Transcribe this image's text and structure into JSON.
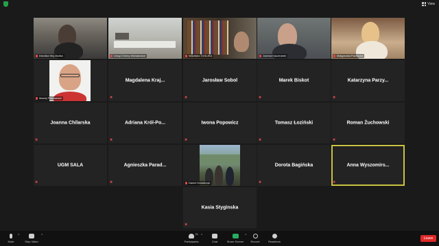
{
  "topbar": {
    "view_label": "View"
  },
  "tiles": [
    {
      "name": "",
      "video_label": "Irlandka Ittry-Bodka",
      "type": "video"
    },
    {
      "name": "",
      "video_label": "Urząd Gminy Michałowice",
      "type": "video"
    },
    {
      "name": "",
      "video_label": "Wachlarz GOŁUKA",
      "type": "video"
    },
    {
      "name": "",
      "video_label": "Joanna Kaczmarek",
      "type": "video"
    },
    {
      "name": "",
      "video_label": "Małgorzata Pachucka",
      "type": "video"
    },
    {
      "name": "",
      "video_label": "Maciej Piwowarski",
      "type": "photo"
    },
    {
      "name": "Magdalena Kraj...",
      "type": "name"
    },
    {
      "name": "Jarosław Sobol",
      "type": "name"
    },
    {
      "name": "Marek Biskot",
      "type": "name"
    },
    {
      "name": "Katarzyna Parzy...",
      "type": "name"
    },
    {
      "name": "Joanna Chilarska",
      "type": "name"
    },
    {
      "name": "Adriana Król-Po...",
      "type": "name"
    },
    {
      "name": "Iwona Popowicz",
      "type": "name"
    },
    {
      "name": "Tomasz Łoziński",
      "type": "name"
    },
    {
      "name": "Roman Żuchowski",
      "type": "name"
    },
    {
      "name": "UGM SALA",
      "type": "name"
    },
    {
      "name": "Agnieszka Parad...",
      "type": "name"
    },
    {
      "name": "",
      "video_label": "Daniel Kowalczyk",
      "type": "photo"
    },
    {
      "name": "Dorota Bagińska",
      "type": "name"
    },
    {
      "name": "Anna Wyszomirs...",
      "type": "name",
      "active": true
    },
    {
      "name": "Kasia Styginska",
      "type": "name"
    }
  ],
  "toolbar": {
    "mute": "Mute",
    "stop_video": "Stop Video",
    "participants": "Participants",
    "participants_count": "21",
    "chat": "Chat",
    "share_screen": "Share Screen",
    "record": "Record",
    "reactions": "Reactions",
    "leave": "Leave"
  },
  "colors": {
    "active_border": "#c9c441",
    "leave": "#e02828",
    "share": "#27ae60",
    "muted": "#e14b4b"
  }
}
